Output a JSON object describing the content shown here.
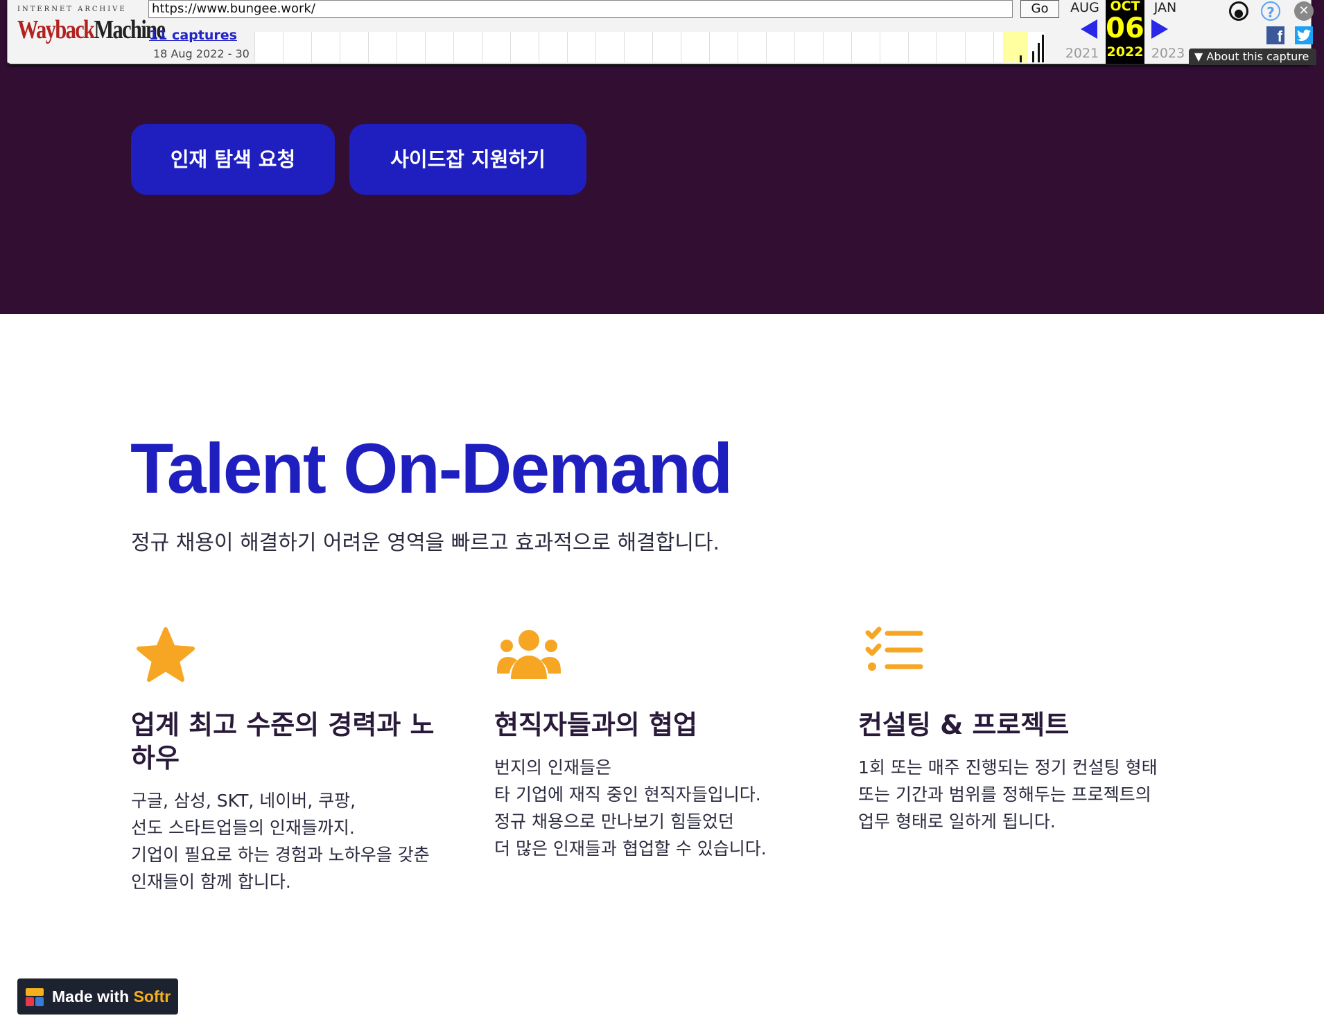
{
  "wayback": {
    "logo_top": "INTERNET ARCHIVE",
    "logo_way": "Wayback",
    "logo_machine": "Machine",
    "url": "https://www.bungee.work/",
    "go_label": "Go",
    "captures_label": "11 captures",
    "range_label": "18 Aug 2022 - 30",
    "prev_month": "AUG",
    "prev_year": "2021",
    "cur_month": "OCT",
    "cur_day": "06",
    "cur_year": "2022",
    "next_month": "JAN",
    "next_year": "2023",
    "about_label": "About this capture",
    "facebook_glyph": "f",
    "twitter_glyph": "t"
  },
  "hero": {
    "btn_talent": "인재 탐색 요청",
    "btn_side": "사이드잡 지원하기"
  },
  "main": {
    "headline": "Talent On-Demand",
    "subhead": "정규 채용이 해결하기 어려운 영역을 빠르고 효과적으로 해결합니다.",
    "features": [
      {
        "icon": "star-icon",
        "title": "업계 최고 수준의 경력과 노하우",
        "body": "구글, 삼성, SKT, 네이버, 쿠팡,\n선도 스타트업들의 인재들까지.\n기업이 필요로 하는 경험과 노하우을 갖춘\n인재들이 함께 합니다."
      },
      {
        "icon": "users-icon",
        "title": "현직자들과의 협업",
        "body": "번지의 인재들은\n타 기업에 재직 중인 현직자들입니다.\n정규 채용으로 만나보기 힘들었던\n더 많은 인재들과 협업할 수 있습니다."
      },
      {
        "icon": "checklist-icon",
        "title": "컨설팅 & 프로젝트",
        "body": "1회 또는 매주 진행되는 정기 컨설팅 형태\n또는 기간과 범위를 정해두는 프로젝트의\n업무 형태로 일하게 됩니다."
      }
    ]
  },
  "badge": {
    "prefix": "Made with ",
    "brand": "Softr"
  },
  "colors": {
    "hero_bg": "#330e33",
    "accent_blue": "#1f1fbf",
    "icon_orange": "#f6a623",
    "softr_yellow": "#f6b01e"
  }
}
